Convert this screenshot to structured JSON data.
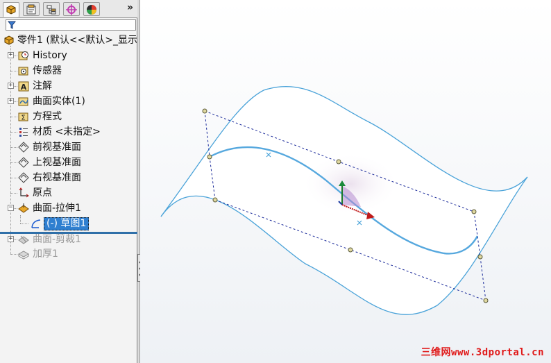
{
  "tabs": [
    {
      "icon": "feature-manager-icon",
      "active": true
    },
    {
      "icon": "property-manager-icon",
      "active": false
    },
    {
      "icon": "configuration-manager-icon",
      "active": false
    },
    {
      "icon": "dimxpert-icon",
      "active": false
    },
    {
      "icon": "display-manager-icon",
      "active": false
    }
  ],
  "tabbar": {
    "more_label": "»"
  },
  "filter": {
    "icon": "filter-icon"
  },
  "tree": {
    "root": {
      "label": "零件1  (默认<<默认>_显示",
      "icon": "part-icon"
    },
    "items": [
      {
        "label": "History",
        "icon": "history-icon",
        "expander": "+"
      },
      {
        "label": "传感器",
        "icon": "sensor-icon",
        "expander": ""
      },
      {
        "label": "注解",
        "icon": "annotation-icon",
        "expander": "+"
      },
      {
        "label": "曲面实体(1)",
        "icon": "surface-bodies-icon",
        "expander": "+"
      },
      {
        "label": "方程式",
        "icon": "equation-icon",
        "expander": ""
      },
      {
        "label": "材质 <未指定>",
        "icon": "material-icon",
        "expander": ""
      },
      {
        "label": "前视基准面",
        "icon": "plane-icon",
        "expander": ""
      },
      {
        "label": "上视基准面",
        "icon": "plane-icon",
        "expander": ""
      },
      {
        "label": "右视基准面",
        "icon": "plane-icon",
        "expander": ""
      },
      {
        "label": "原点",
        "icon": "origin-icon",
        "expander": ""
      },
      {
        "label": "曲面-拉伸1",
        "icon": "extruded-surface-icon",
        "expander": "−"
      },
      {
        "label": "(-) 草图1",
        "icon": "sketch-icon",
        "expander": "",
        "selected": true
      },
      {
        "label": "曲面-剪裁1",
        "icon": "trim-surface-icon",
        "expander": "+",
        "suppressed": true
      },
      {
        "label": "加厚1",
        "icon": "thicken-icon",
        "expander": "",
        "suppressed": true
      }
    ]
  },
  "watermark": {
    "text": "三维网www.3dportal.cn",
    "color": "#e01a1a"
  },
  "colors": {
    "surface_edge": "#4aa3d9",
    "handle_line": "#1a2a9a",
    "selection_blue": "#2f7fd0"
  }
}
